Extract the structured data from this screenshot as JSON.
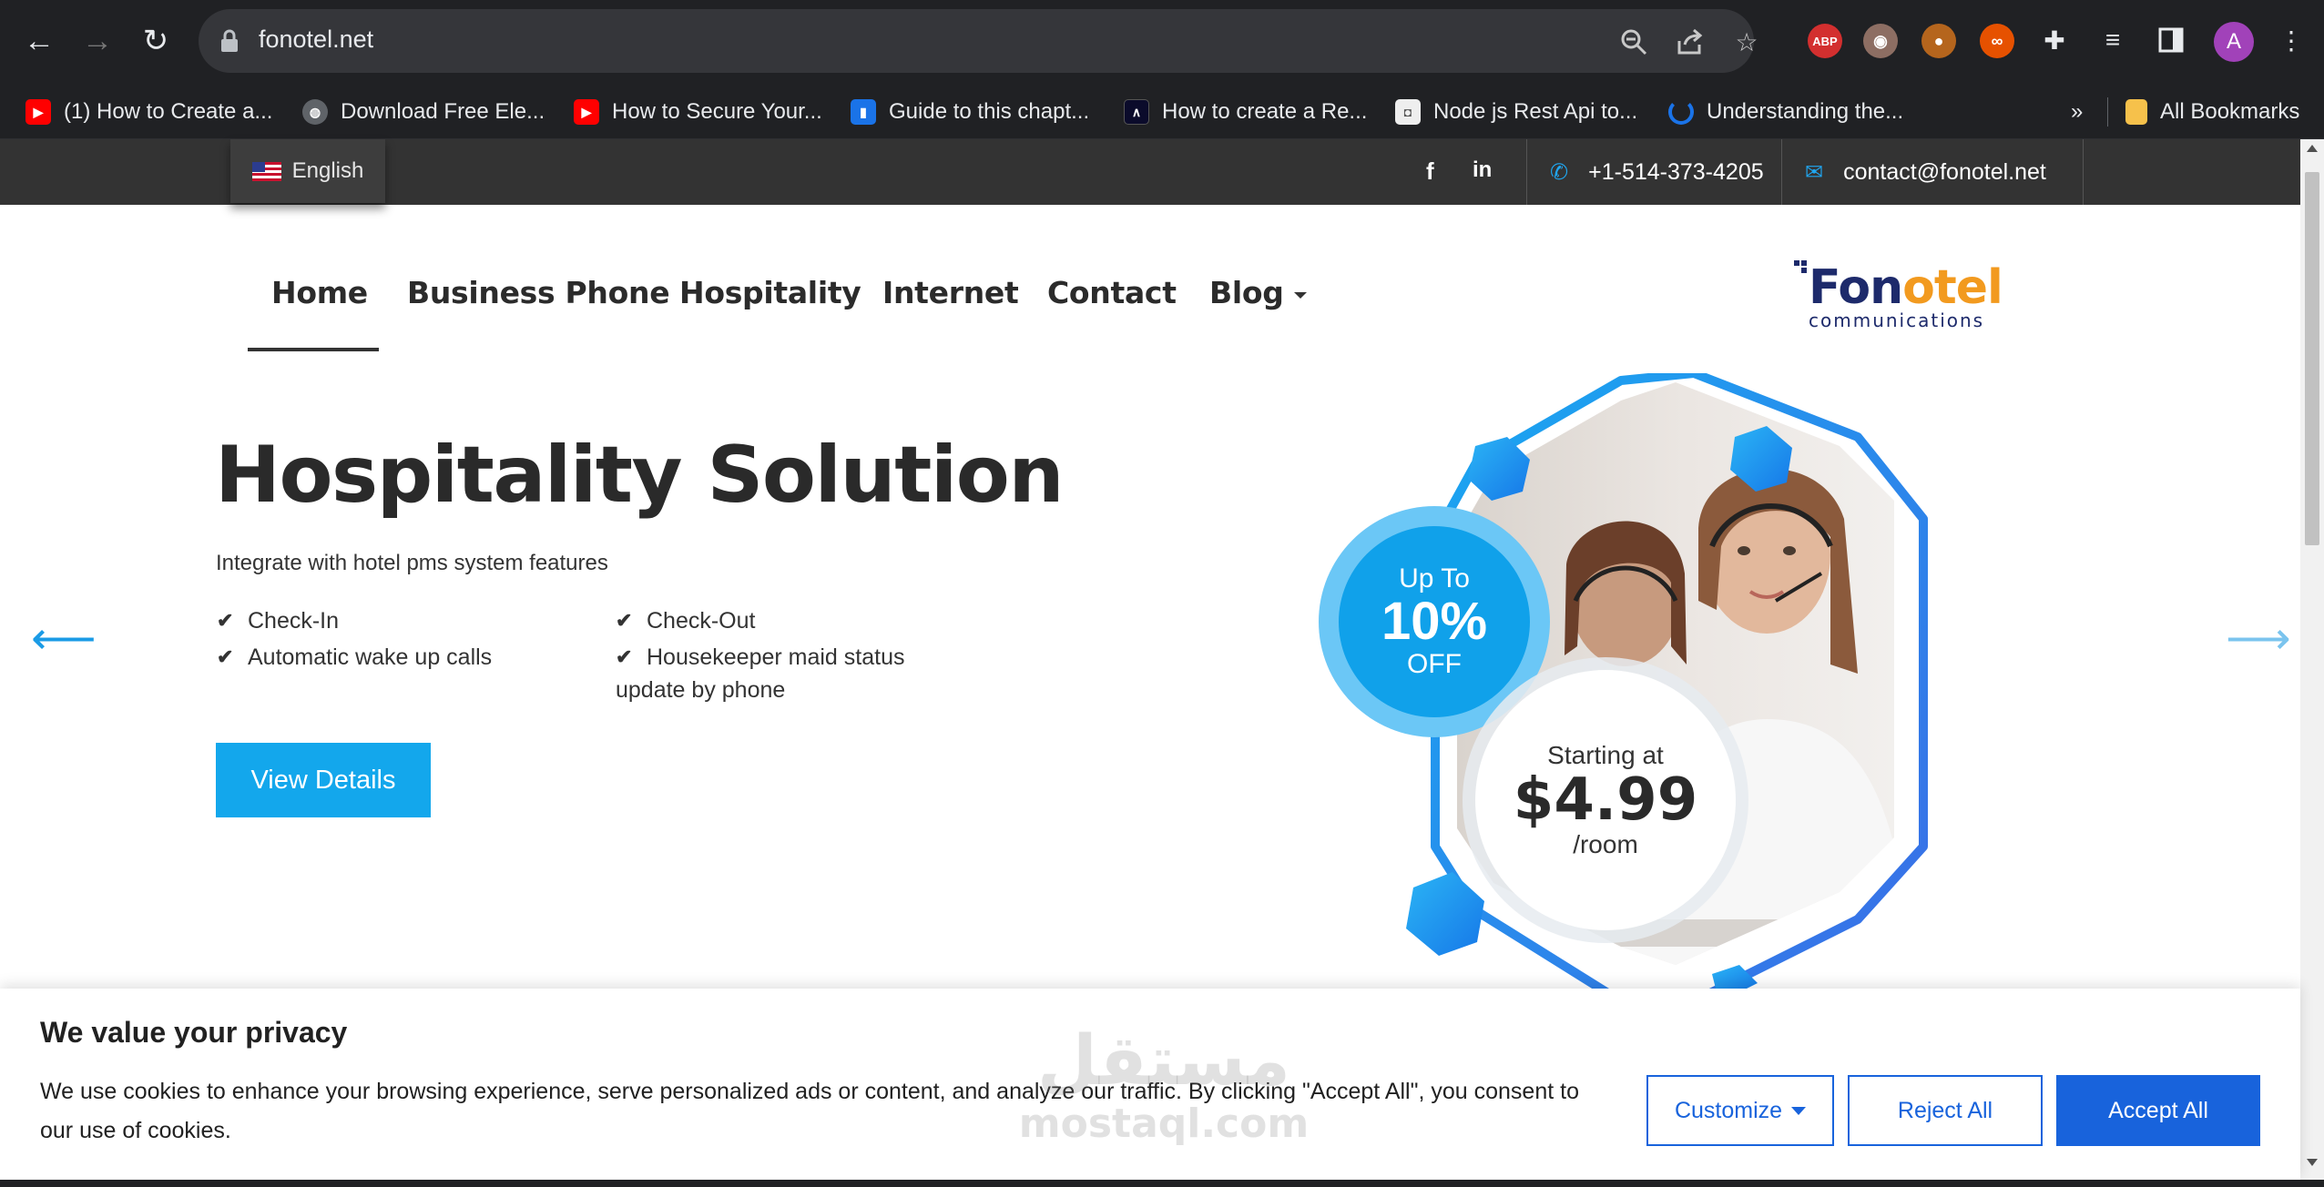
{
  "browser": {
    "url": "fonotel.net",
    "profile_initial": "A",
    "bookmarks": [
      {
        "label": "(1) How to Create a...",
        "icon": "youtube-icon"
      },
      {
        "label": "Download Free Ele...",
        "icon": "globe-icon"
      },
      {
        "label": "How to Secure Your...",
        "icon": "youtube-icon"
      },
      {
        "label": "Guide to this chapt...",
        "icon": "book-icon"
      },
      {
        "label": "How to create a Re...",
        "icon": "react-icon"
      },
      {
        "label": "Node js Rest Api to...",
        "icon": "page-icon"
      },
      {
        "label": "Understanding the...",
        "icon": "spinner-icon"
      }
    ],
    "bookmarks_overflow": "»",
    "all_bookmarks": "All Bookmarks",
    "extension_abp": "ABP"
  },
  "topbar": {
    "language": "English",
    "phone": "+1-514-373-4205",
    "email": "contact@fonotel.net"
  },
  "nav": {
    "items": [
      "Home",
      "Business Phone",
      "Hospitality",
      "Internet",
      "Contact",
      "Blog"
    ]
  },
  "logo": {
    "name_part1": "Fon",
    "name_part2": "o",
    "name_part3": "tel",
    "tagline": "communications"
  },
  "hero": {
    "title": "Hospitality Solution",
    "subtitle": "Integrate with hotel pms system features",
    "features_left": [
      "Check-In",
      "Automatic wake up calls"
    ],
    "features_right": [
      "Check-Out",
      "Housekeeper maid status",
      "update by phone"
    ],
    "cta": "View Details",
    "discount": {
      "line1": "Up To",
      "line2": "10%",
      "line3": "OFF"
    },
    "price": {
      "line1": "Starting at",
      "line2": "$4.99",
      "line3": "/room"
    }
  },
  "cookie": {
    "title": "We value your privacy",
    "body": "We use cookies to enhance your browsing experience, serve personalized ads or content, and analyze our traffic. By clicking \"Accept All\", you consent to our use of cookies.",
    "customize": "Customize",
    "reject": "Reject All",
    "accept": "Accept All"
  },
  "watermark": {
    "line1": "مستقل",
    "line2": "mostaql.com"
  },
  "colors": {
    "accent": "#13a7ec",
    "cookie_blue": "#1863dc",
    "topbar": "#333333",
    "logo_navy": "#1d2a6b",
    "logo_orange": "#f29a1f"
  }
}
